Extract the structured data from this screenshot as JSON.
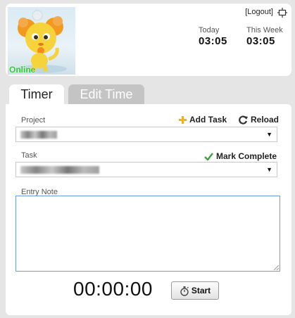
{
  "user": {
    "status": "Online",
    "logout_label": "[Logout]"
  },
  "stats": {
    "today_label": "Today",
    "today_value": "03:05",
    "week_label": "This Week",
    "week_value": "03:05"
  },
  "tabs": [
    {
      "label": "Timer",
      "active": true
    },
    {
      "label": "Edit Time",
      "active": false
    }
  ],
  "form": {
    "project_label": "Project",
    "project_value": "",
    "add_task_label": "Add Task",
    "reload_label": "Reload",
    "task_label": "Task",
    "task_value": "",
    "mark_complete_label": "Mark Complete",
    "entry_note_label": "Entry Note",
    "entry_note_value": ""
  },
  "timer": {
    "display": "00:00:00",
    "start_label": "Start"
  },
  "colors": {
    "online": "#2ecc2e",
    "add_icon": "#f0b020",
    "check_icon": "#3aa33a",
    "note_border": "#6aa0d8"
  }
}
